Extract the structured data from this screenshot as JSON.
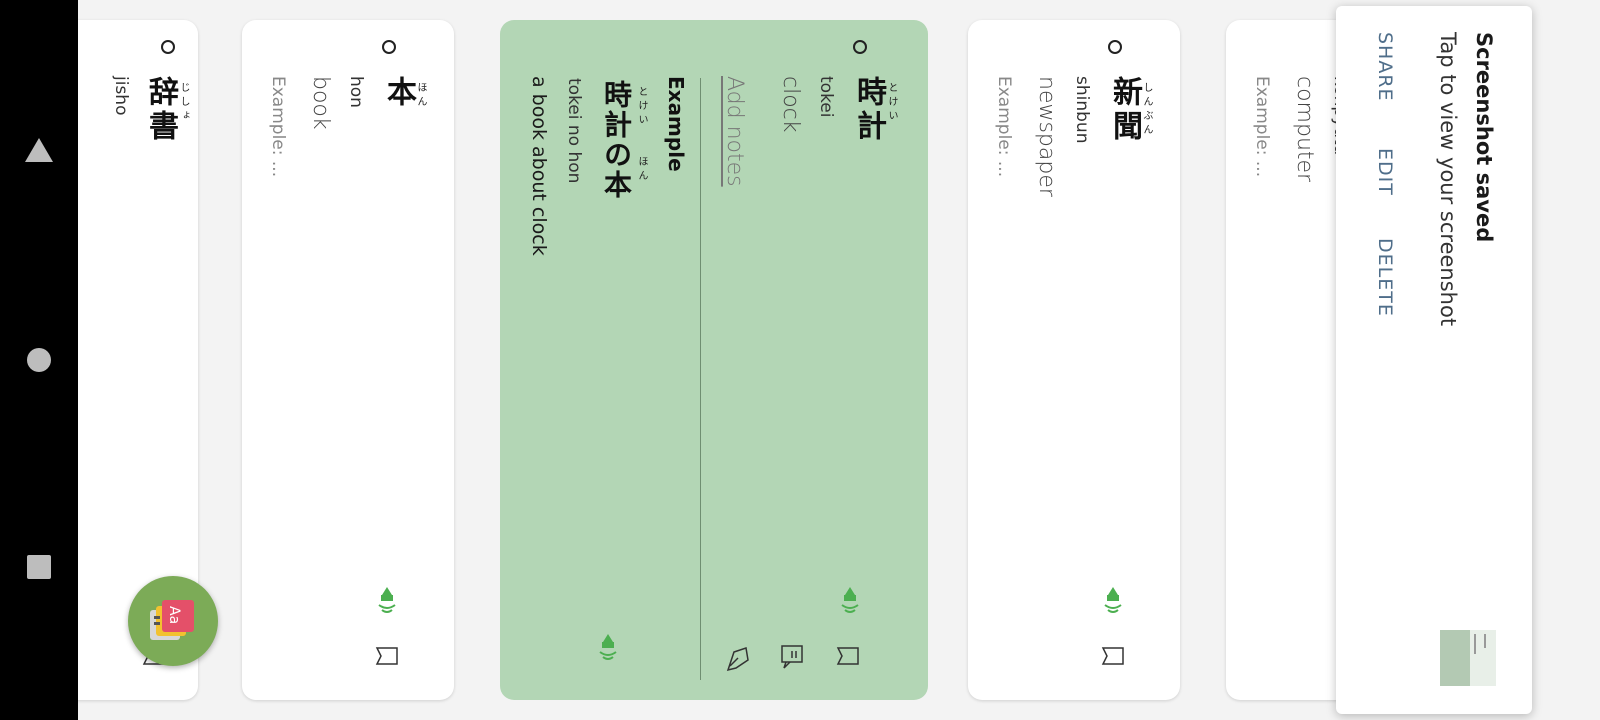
{
  "nav": {
    "back": "back-triangle",
    "home": "home-circle",
    "recents": "recents-square"
  },
  "cards": [
    {
      "furigana": "じしょ",
      "word": "辞書",
      "romaji": "jisho"
    },
    {
      "furigana": "ほん",
      "word": "本",
      "romaji": "hon",
      "meaning": "book",
      "example": "Example: ..."
    },
    {
      "furigana": "とけい",
      "word": "時計",
      "romaji": "tokei",
      "meaning": "clock",
      "notes": "Add notes",
      "example_heading": "Example",
      "example_furigana": "とけい　　ほん",
      "example_sentence": "時計の本",
      "example_romaji": "tokei no hon",
      "example_translation": "a book about clock"
    },
    {
      "furigana": "しんぶん",
      "word": "新聞",
      "romaji": "shinbun",
      "meaning": "newspaper",
      "example": "Example: ..."
    },
    {
      "romaji": "konpyūta",
      "meaning": "computer",
      "example": "Example: ..."
    }
  ],
  "fab": {
    "icon": "dictionary-app-icon",
    "label": "Aa"
  },
  "toast": {
    "title": "Screenshot saved",
    "subtitle": "Tap to view your screenshot",
    "share": "SHARE",
    "edit": "EDIT",
    "delete": "DELETE"
  },
  "colors": {
    "accent": "#4caf50",
    "active_card": "#b3d6b5",
    "fab": "#7cab57"
  }
}
